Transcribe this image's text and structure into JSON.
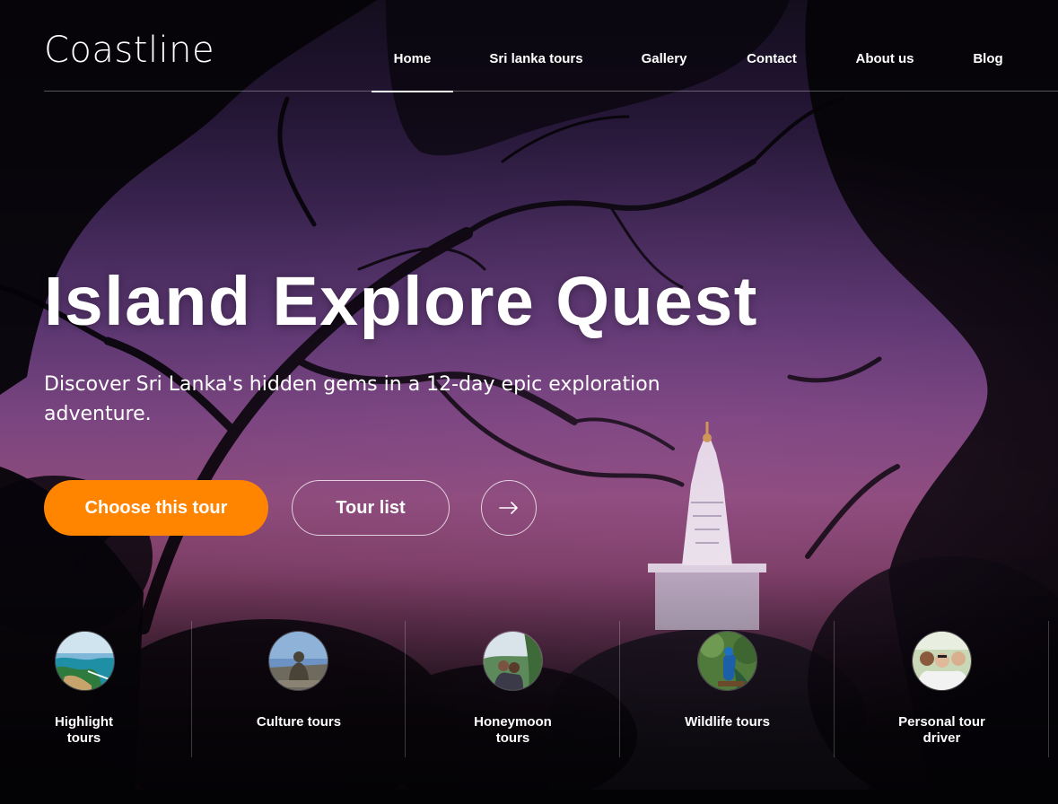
{
  "brand": {
    "logo_text": "Coastline"
  },
  "nav": {
    "items": [
      {
        "label": "Home",
        "active": true
      },
      {
        "label": "Sri lanka tours",
        "active": false
      },
      {
        "label": "Gallery",
        "active": false
      },
      {
        "label": "Contact",
        "active": false
      },
      {
        "label": "About us",
        "active": false
      },
      {
        "label": "Blog",
        "active": false
      }
    ]
  },
  "hero": {
    "title": "Island Explore Quest",
    "subtitle": "Discover Sri Lanka's hidden gems in a 12-day epic exploration adventure.",
    "primary_button": "Choose this tour",
    "secondary_button": "Tour list",
    "arrow_button_icon": "arrow-right-icon"
  },
  "categories": [
    {
      "label_line1": "Highlight",
      "label_line2": "tours",
      "icon": "coast-photo"
    },
    {
      "label_line1": "Culture tours",
      "label_line2": "",
      "icon": "buddha-statue-photo"
    },
    {
      "label_line1": "Honeymoon",
      "label_line2": "tours",
      "icon": "couple-photo"
    },
    {
      "label_line1": "Wildlife tours",
      "label_line2": "",
      "icon": "peacock-photo"
    },
    {
      "label_line1": "Personal tour",
      "label_line2": "driver",
      "icon": "group-selfie-photo"
    }
  ],
  "colors": {
    "accent": "#ff8400",
    "text": "#ffffff",
    "sky_top": "#161022",
    "sky_mid": "#7a4580"
  }
}
